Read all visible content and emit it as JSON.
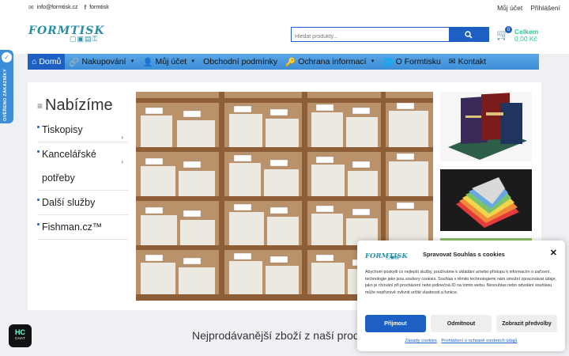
{
  "topbar": {
    "email": "info@formtisk.cz",
    "facebook": "formtisk",
    "account": "Můj účet",
    "login": "Přihlášení"
  },
  "header": {
    "logo_text": "FORMTISK",
    "search_placeholder": "Hledat produkty...",
    "cart_title": "Celkem",
    "cart_amount": "0,00 Kč",
    "cart_count": "0"
  },
  "nav": {
    "items": [
      {
        "label": "Domů",
        "icon": "home-icon",
        "active": true
      },
      {
        "label": "Nakupování",
        "icon": "link-icon",
        "dropdown": true
      },
      {
        "label": "Můj účet",
        "icon": "user-icon",
        "dropdown": true
      },
      {
        "label": "Obchodní podmínky"
      },
      {
        "label": "Ochrana informací",
        "icon": "key-icon",
        "dropdown": true
      },
      {
        "label": "O Formtisku",
        "icon": "globe-icon"
      },
      {
        "label": "Kontakt",
        "icon": "envelope-icon"
      }
    ]
  },
  "side_badge": "OVĚŘENO ZÁKAZNÍKY",
  "menu": {
    "title": "Nabízíme",
    "items": [
      {
        "line1": "Tiskopisy",
        "arrow": true
      },
      {
        "line1": "Kancelářské",
        "line2": "potřeby",
        "arrow": true
      },
      {
        "line1": "Další služby"
      },
      {
        "line1": "Fishman.cz™"
      }
    ]
  },
  "section_title": "Nejprodávanější zboží z naší prod",
  "chat": {
    "line1": "HC",
    "line2": "CHAT"
  },
  "consent": {
    "logo_text": "FORMTISK",
    "title": "Spravovat Souhlas s cookies",
    "body": "Abychom poskytli co nejlepší služby, používáme k ukládání a/nebo přístupu k informacím o zařízení, technologie jako jsou soubory cookies. Souhlas s těmito technologiemi nám umožní zpracovávat údaje, jako je chování při procházení nebo jedinečná ID na tomto webu. Nesouhlas nebo odvolání souhlasu může nepříznivě ovlivnit určité vlastnosti a funkce.",
    "accept": "Přijmout",
    "deny": "Odmítnout",
    "prefs": "Zobrazit předvolby",
    "link1": "Zásady cookies",
    "link2": "Prohlášení o ochraně osobních údajů"
  },
  "colors": {
    "accent": "#1e5fc4",
    "nav": "#3d8ed8",
    "cart": "#2ec4a0"
  }
}
